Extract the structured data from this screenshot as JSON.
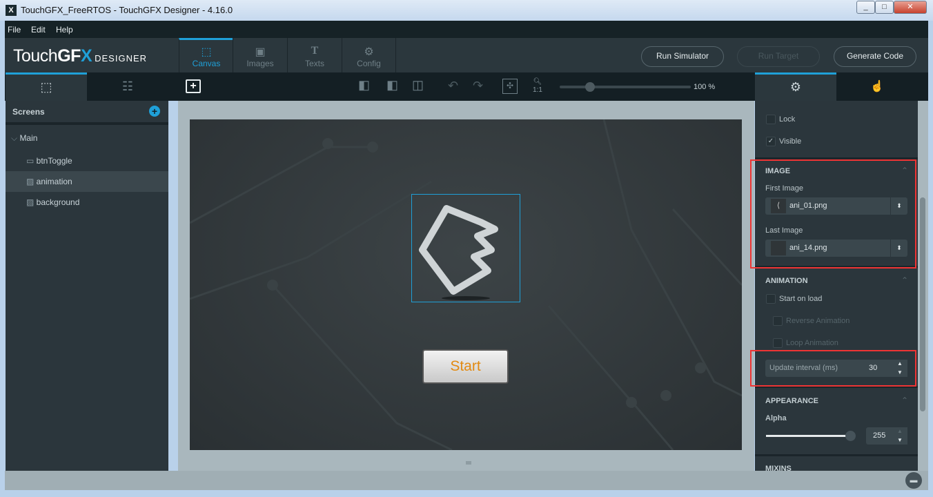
{
  "window": {
    "title": "TouchGFX_FreeRTOS - TouchGFX Designer - 4.16.0",
    "minimize": "_",
    "maximize": "□",
    "close": "✕"
  },
  "menu": [
    "File",
    "Edit",
    "Help"
  ],
  "logo": {
    "main": "Touch",
    "bold": "GF",
    "x": "X",
    "sub": "DESIGNER"
  },
  "tabs": [
    {
      "label": "Canvas",
      "icon": "canvas-icon"
    },
    {
      "label": "Images",
      "icon": "image-icon"
    },
    {
      "label": "Texts",
      "icon": "text-icon"
    },
    {
      "label": "Config",
      "icon": "gear-icon"
    }
  ],
  "buttons": {
    "run_simulator": "Run Simulator",
    "run_target": "Run Target",
    "generate_code": "Generate Code"
  },
  "toolbar": {
    "zoom_label": "1:1",
    "zoom_percent": "100 %",
    "zoom_value": 100
  },
  "screens": {
    "title": "Screens",
    "items": [
      {
        "label": "Main"
      },
      {
        "label": "btnToggle"
      },
      {
        "label": "animation"
      },
      {
        "label": "background"
      }
    ]
  },
  "canvas": {
    "start_button": "Start"
  },
  "properties": {
    "lock": "Lock",
    "visible": "Visible",
    "image": {
      "title": "IMAGE",
      "first_label": "First Image",
      "first_value": "ani_01.png",
      "last_label": "Last Image",
      "last_value": "ani_14.png"
    },
    "animation": {
      "title": "ANIMATION",
      "start_on_load": "Start on load",
      "reverse": "Reverse Animation",
      "loop": "Loop Animation",
      "interval_label": "Update interval (ms)",
      "interval_value": "30"
    },
    "appearance": {
      "title": "APPEARANCE",
      "alpha_label": "Alpha",
      "alpha_value": "255"
    },
    "mixins": {
      "title": "MIXINS"
    }
  },
  "colors": {
    "accent": "#1fa0d8",
    "highlight": "#ef3434",
    "start_text": "#e28a12"
  }
}
